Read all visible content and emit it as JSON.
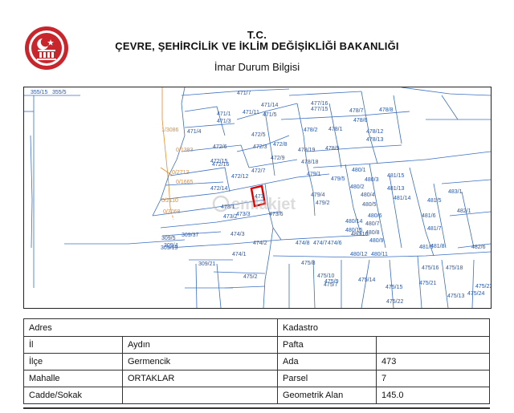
{
  "header": {
    "line1": "T.C.",
    "line2": "ÇEVRE, ŞEHİRCİLİK VE İKLİM DEĞİŞİKLİĞİ BAKANLIĞI",
    "line3": "İmar Durum Bilgisi"
  },
  "logo": {
    "icon": "ministry-seal-icon",
    "color": "#c8252c"
  },
  "map": {
    "watermark": "emlakjet",
    "highlight_color": "#d60000",
    "line_color": "#3a6fc0",
    "label_color": "#2a57a8",
    "labels": [
      "355/15",
      "355/5",
      "471/7",
      "471/1",
      "471/14",
      "477/16",
      "477/15",
      "471/3",
      "471/5",
      "471/4",
      "478/7",
      "478/8",
      "471/11",
      "478/1",
      "478/6",
      "478/12",
      "478/2",
      "472/6",
      "472/5",
      "478/13",
      "472/15",
      "472/3",
      "472/8",
      "478/19",
      "478/9",
      "472/16",
      "472/9",
      "478/18",
      "472/7",
      "480/1",
      "481/15",
      "472/12",
      "479/1",
      "479/5",
      "480/3",
      "472/14",
      "480/2",
      "481/13",
      "473/1",
      "479/4",
      "480/4",
      "481/14",
      "481/5",
      "483/1",
      "473/3",
      "473/6",
      "479/2",
      "480/5",
      "482/1",
      "473/2",
      "480/14",
      "480/6",
      "481/6",
      "480/15",
      "480/7",
      "474/3",
      "480/16",
      "480/8",
      "481/7",
      "474/2",
      "474/8",
      "474/7",
      "474/6",
      "480/9",
      "482/6",
      "474/1",
      "480/12",
      "480/11",
      "481/9",
      "481/8",
      "309/5",
      "309/4",
      "309/37",
      "309/19",
      "309/21",
      "475/8",
      "475/2",
      "475/10",
      "475/9",
      "475/7",
      "475/14",
      "475/15",
      "475/16",
      "475/18",
      "475/21",
      "475/13",
      "475/22",
      "475/23",
      "475/24",
      "1/3086",
      "0/1383",
      "0/2712",
      "0/1665",
      "0/2110",
      "0/3068",
      "473"
    ]
  },
  "info_table": {
    "left_header": "Adres",
    "right_header": "Kadastro",
    "rows": [
      {
        "label": "İl",
        "value": "Aydın",
        "rlabel": "Pafta",
        "rvalue": ""
      },
      {
        "label": "İlçe",
        "value": "Germencik",
        "rlabel": "Ada",
        "rvalue": "473"
      },
      {
        "label": "Mahalle",
        "value": "ORTAKLAR",
        "rlabel": "Parsel",
        "rvalue": "7"
      },
      {
        "label": "Cadde/Sokak",
        "value": "",
        "rlabel": "Geometrik Alan",
        "rvalue": "145.0"
      }
    ]
  }
}
